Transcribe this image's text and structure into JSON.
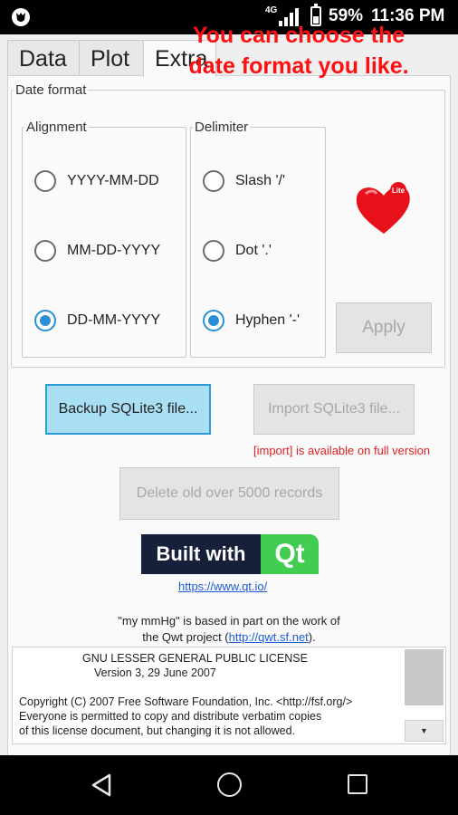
{
  "status_bar": {
    "network": "4G",
    "battery": "59%",
    "time": "11:36 PM"
  },
  "tabs": [
    {
      "label": "Data"
    },
    {
      "label": "Plot"
    },
    {
      "label": "Extra"
    }
  ],
  "overlay": {
    "line1": "You can choose  the",
    "line2": "date format you like."
  },
  "date_format": {
    "title": "Date format",
    "alignment": {
      "title": "Alignment",
      "options": [
        "YYYY-MM-DD",
        "MM-DD-YYYY",
        "DD-MM-YYYY"
      ],
      "selected": "DD-MM-YYYY"
    },
    "delimiter": {
      "title": "Delimiter",
      "options": [
        "Slash '/'",
        "Dot '.'",
        "Hyphen '-'"
      ],
      "selected": "Hyphen '-'"
    },
    "apply_label": "Apply",
    "heart_badge": "Lite"
  },
  "actions": {
    "backup_label": "Backup SQLite3 file...",
    "import_label": "Import SQLite3 file...",
    "import_note": "[import] is available on full version",
    "delete_label": "Delete old  over 5000 records"
  },
  "qt": {
    "built_with": "Built with",
    "qt": "Qt",
    "link": "https://www.qt.io/"
  },
  "credits": {
    "line1": "\"my mmHg\" is based in part on the work of",
    "line2_prefix": "the Qwt project (",
    "qwt_link": "http://qwt.sf.net",
    "line2_suffix": ")."
  },
  "license": {
    "line1": "GNU LESSER GENERAL PUBLIC LICENSE",
    "line2": "Version 3, 29 June 2007",
    "line3": "Copyright (C) 2007 Free Software Foundation, Inc. <http://fsf.org/>",
    "line4": "Everyone is permitted to copy and distribute verbatim copies",
    "line5": "of this license document, but changing it is not allowed."
  },
  "colors": {
    "accent": "#2a8fd4",
    "overlay_red": "#ff1010",
    "qt_green": "#41cd52",
    "qt_navy": "#17203a"
  }
}
